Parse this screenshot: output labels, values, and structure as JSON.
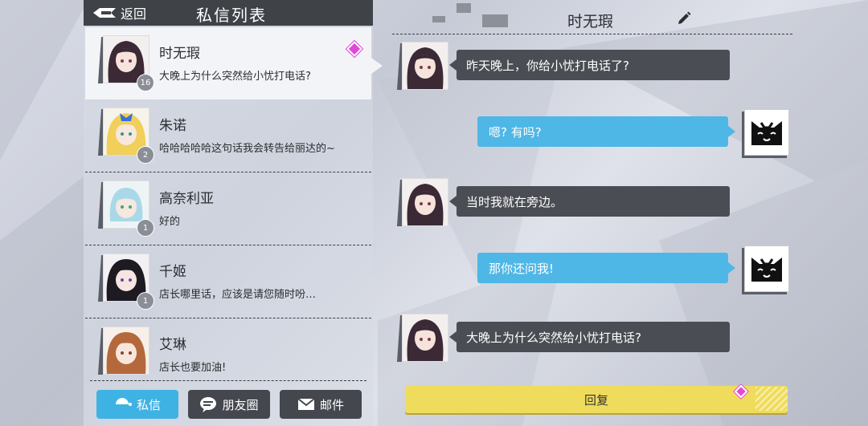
{
  "header": {
    "back_label": "返回",
    "title": "私信列表"
  },
  "conversations": [
    {
      "name": "时无瑕",
      "preview": "大晚上为什么突然给小忧打电话?",
      "badge": "16",
      "avatar": "hair-dark"
    },
    {
      "name": "朱诺",
      "preview": "哈哈哈哈哈这句话我会转告给丽达的~",
      "badge": "2",
      "avatar": "hair-blonde"
    },
    {
      "name": "高奈利亚",
      "preview": "好的",
      "badge": "1",
      "avatar": "hair-lightblue"
    },
    {
      "name": "千姬",
      "preview": "店长哪里话，应该是请您随时吩…",
      "badge": "1",
      "avatar": "hair-black"
    },
    {
      "name": "艾琳",
      "preview": "店长也要加油!",
      "badge": "",
      "avatar": "hair-brown"
    }
  ],
  "nav": [
    {
      "label": "私信",
      "icon": "chat-icon"
    },
    {
      "label": "朋友圈",
      "icon": "moments-icon"
    },
    {
      "label": "邮件",
      "icon": "mail-icon"
    }
  ],
  "chat": {
    "title": "时无瑕",
    "messages": [
      {
        "from": "other",
        "text": "昨天晚上，你给小忧打电话了?"
      },
      {
        "from": "me",
        "text": "嗯? 有吗?"
      },
      {
        "from": "other",
        "text": "当时我就在旁边。"
      },
      {
        "from": "me",
        "text": "那你还问我!"
      },
      {
        "from": "other",
        "text": "大晚上为什么突然给小忧打电话?"
      }
    ],
    "reply_label": "回复"
  },
  "colors": {
    "accent_blue": "#3fb2e4",
    "reply_yellow": "#f0dc5c",
    "unread_pink": "#e048d8",
    "dark": "#44474d"
  }
}
